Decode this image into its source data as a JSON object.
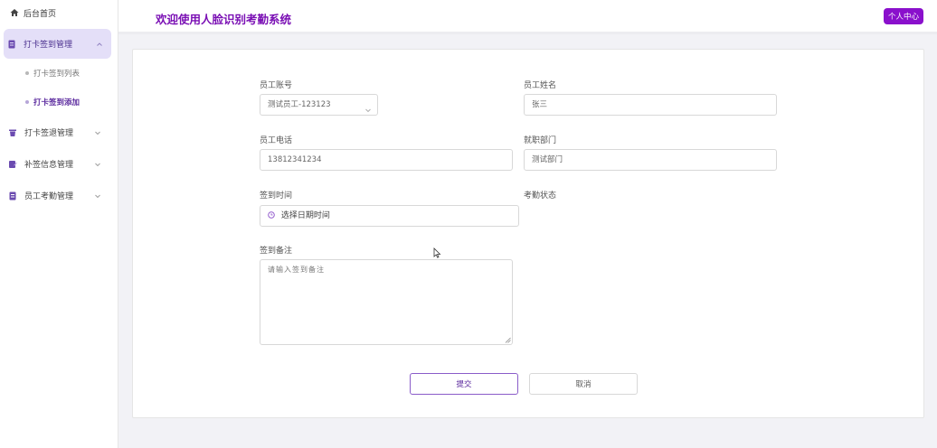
{
  "sidebar": {
    "home": {
      "label": "后台首页",
      "icon": "home-icon"
    },
    "menus": [
      {
        "label": "打卡签到管理",
        "icon": "document-icon",
        "expanded": true,
        "children": [
          {
            "label": "打卡签到列表"
          },
          {
            "label": "打卡签到添加"
          }
        ]
      },
      {
        "label": "打卡签退管理",
        "icon": "trash-icon",
        "expanded": false
      },
      {
        "label": "补签信息管理",
        "icon": "edit-icon",
        "expanded": false
      },
      {
        "label": "员工考勤管理",
        "icon": "document-icon",
        "expanded": false
      }
    ]
  },
  "header": {
    "title": "欢迎使用人脸识别考勤系统",
    "user_button": "个人中心"
  },
  "form": {
    "employee_account": {
      "label": "员工账号",
      "value": "测试员工-123123"
    },
    "employee_name": {
      "label": "员工姓名",
      "value": "张三"
    },
    "employee_phone": {
      "label": "员工电话",
      "value": "13812341234"
    },
    "department": {
      "label": "就职部门",
      "value": "测试部门"
    },
    "signin_time": {
      "label": "签到时间",
      "placeholder": "选择日期时间"
    },
    "attendance_status": {
      "label": "考勤状态"
    },
    "signin_remark": {
      "label": "签到备注",
      "placeholder": "请输入签到备注"
    },
    "submit": "提交",
    "cancel": "取消"
  },
  "colors": {
    "accent": "#8a10cc",
    "title": "#7a0fb4",
    "active_bg": "#e4dff8"
  }
}
